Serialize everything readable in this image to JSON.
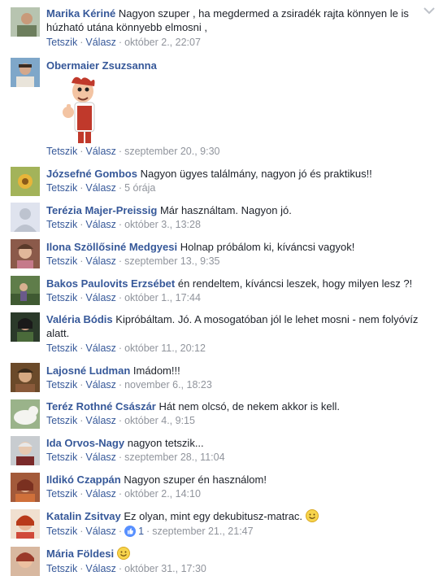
{
  "actions": {
    "like": "Tetszik",
    "reply": "Válasz"
  },
  "comments": [
    {
      "author": "Marika Kériné",
      "text": "Nagyon szuper , ha megdermed a zsiradék rajta könnyen le is húzható utána könnyebb elmosni ,",
      "time": "október 2., 22:07"
    },
    {
      "author": "Obermaier Zsuzsanna",
      "text": "",
      "time": "szeptember 20., 9:30"
    },
    {
      "author": "Józsefné Gombos",
      "text": "Nagyon ügyes találmány, nagyon jó és praktikus!!",
      "time": "5 órája"
    },
    {
      "author": "Terézia Majer-Preissig",
      "text": "Már használtam. Nagyon jó.",
      "time": "október 3., 13:28"
    },
    {
      "author": "Ilona Szöllősiné Medgyesi",
      "text": "Holnap próbálom ki, kíváncsi vagyok!",
      "time": "szeptember 13., 9:35"
    },
    {
      "author": "Bakos Paulovits Erzsébet",
      "text": "én rendeltem, kíváncsi leszek, hogy milyen lesz ?!",
      "time": "október 1., 17:44"
    },
    {
      "author": "Valéria Bódis",
      "text": "Kipróbáltam. Jó. A mosogatóban jól le lehet mosni - nem folyóvíz alatt.",
      "time": "október 11., 20:12"
    },
    {
      "author": "Lajosné Ludman",
      "text": "Imádom!!!",
      "time": "november 6., 18:23"
    },
    {
      "author": "Teréz Rothné Császár",
      "text": "Hát nem olcsó, de nekem akkor is kell.",
      "time": "október 4., 9:15"
    },
    {
      "author": "Ida Orvos-Nagy",
      "text": "nagyon tetszik...",
      "time": "szeptember 28., 11:04"
    },
    {
      "author": "Ildikó Czappán",
      "text": "Nagyon szuper én használom!",
      "time": "október 2., 14:10"
    },
    {
      "author": "Katalin Zsitvay",
      "text": "Ez olyan, mint egy dekubitusz-matrac.",
      "time": "szeptember 21., 21:47",
      "likes": "1"
    },
    {
      "author": "Mária Földesi",
      "text": "",
      "time": "október 31., 17:30"
    }
  ],
  "colors": {
    "link": "#365899",
    "meta": "#90949c",
    "text": "#1d2129"
  }
}
